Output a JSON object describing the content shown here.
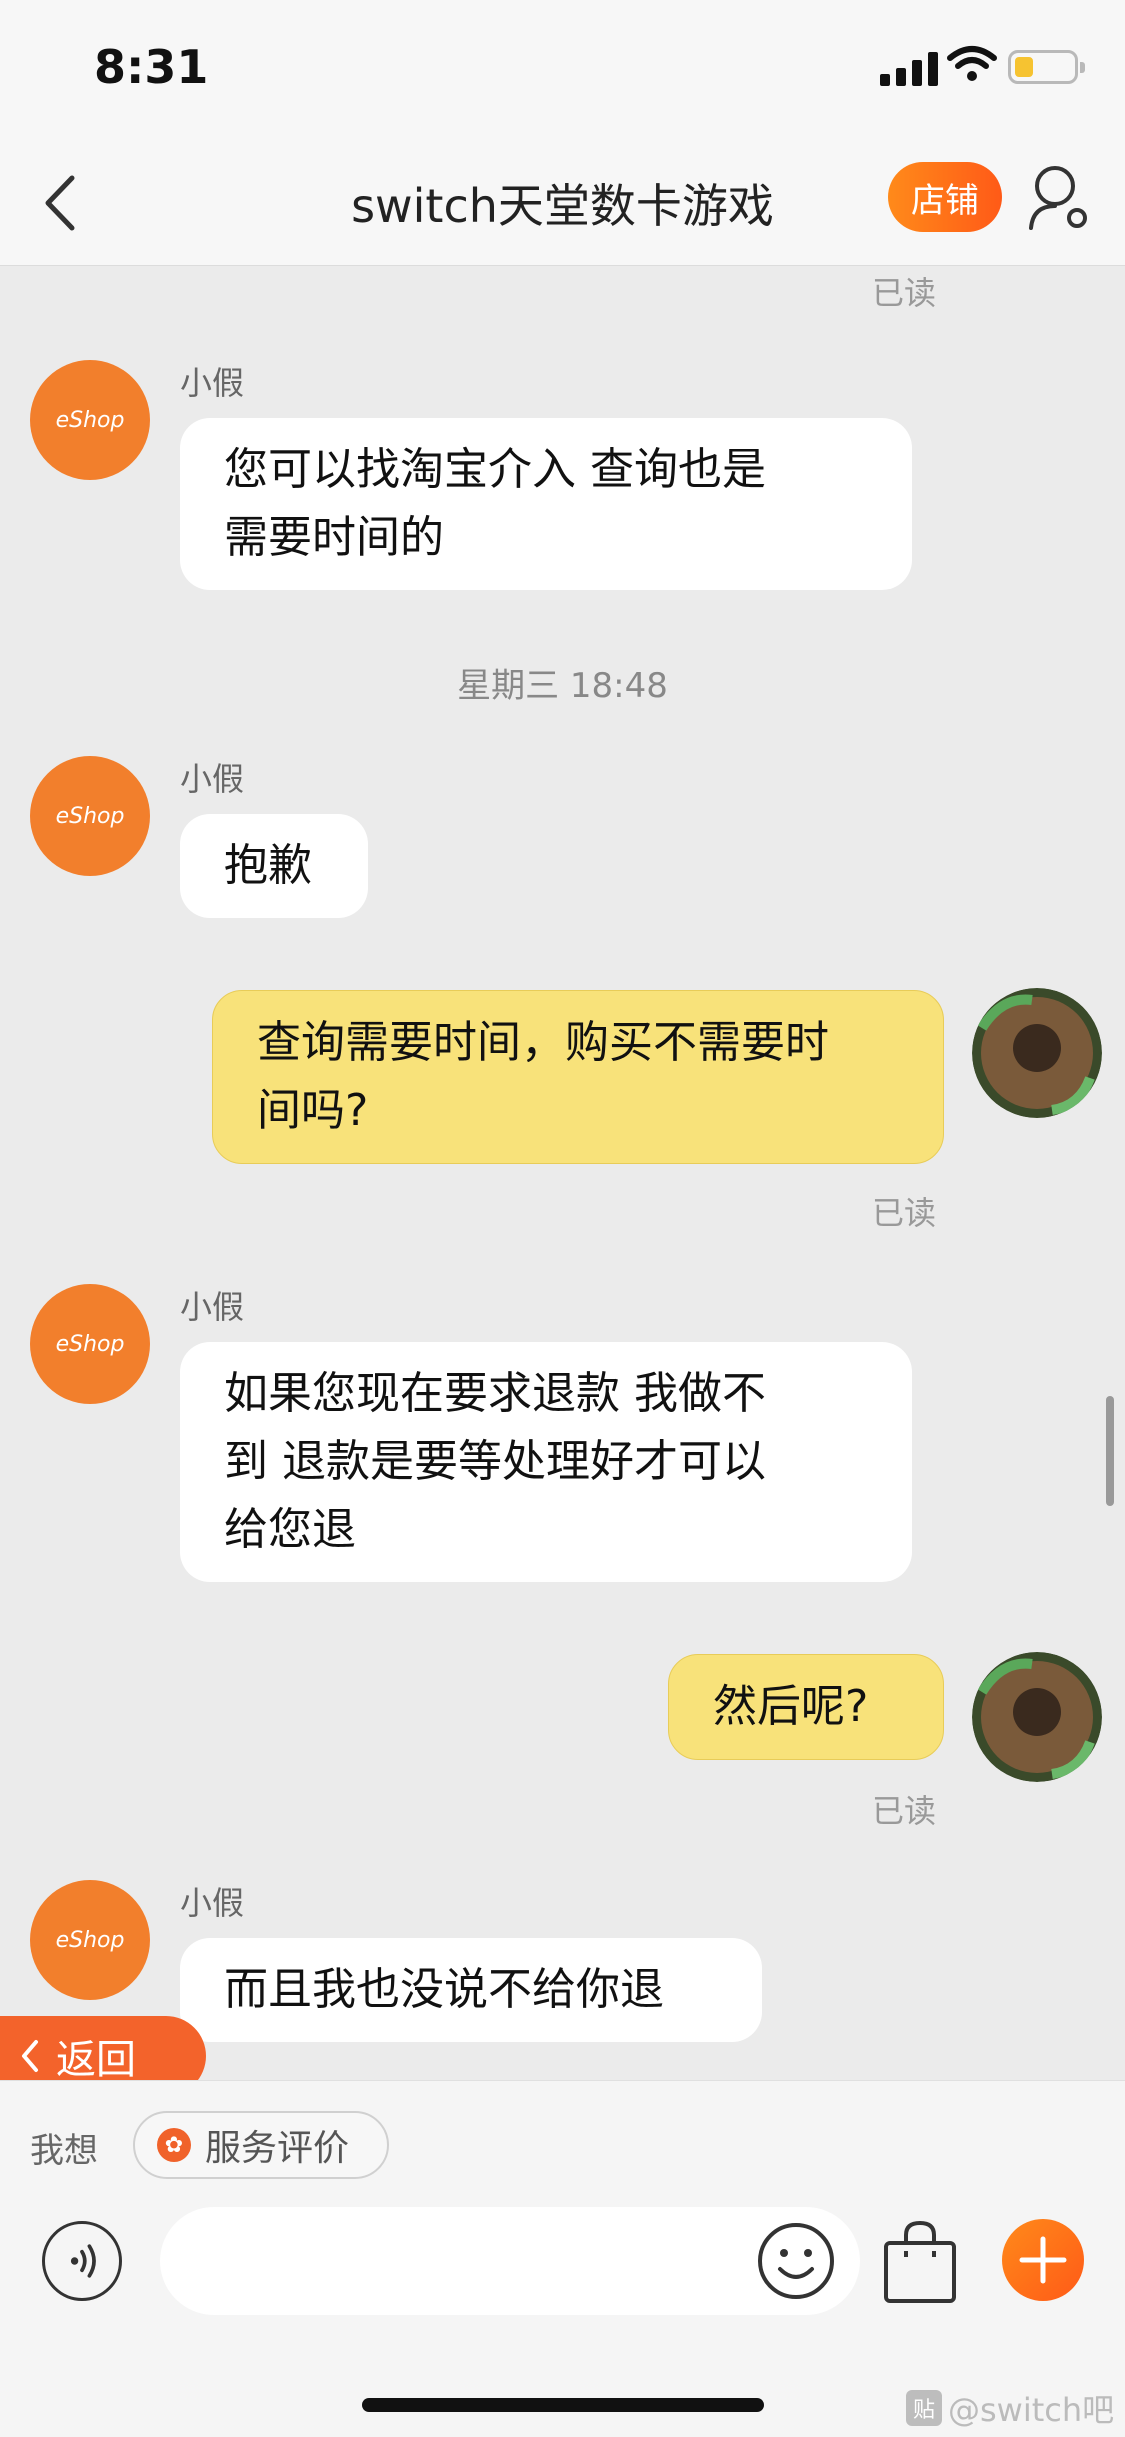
{
  "status": {
    "time": "8:31"
  },
  "nav": {
    "title": "switch天堂数卡游戏",
    "shop_label": "店铺"
  },
  "avatar_text": "eShop",
  "messages": {
    "read0": "已读",
    "m1": {
      "sender": "小假",
      "text_l1": "您可以找淘宝介入  查询也是",
      "text_l2": "需要时间的"
    },
    "stamp1": "星期三 18:48",
    "m2": {
      "sender": "小假",
      "text": "抱歉"
    },
    "m3": {
      "text_l1": "查询需要时间，购买不需要时",
      "text_l2": "间吗?"
    },
    "read1": "已读",
    "m4": {
      "sender": "小假",
      "text_l1": "如果您现在要求退款  我做不",
      "text_l2": "到 退款是要等处理好才可以",
      "text_l3": "给您退"
    },
    "m5": {
      "text": "然后呢?"
    },
    "read2": "已读",
    "m6": {
      "sender": "小假",
      "text": "而且我也没说不给你退"
    }
  },
  "return_button": {
    "label": "返回"
  },
  "bottom": {
    "wish_label": "我想",
    "eval_chip": "服务评价",
    "input_value": ""
  },
  "watermark": {
    "text": "@switch吧",
    "badge": "贴"
  },
  "colors": {
    "accent": "#ff6a1a",
    "my_bubble": "#f8e27a",
    "background": "#ebebeb"
  }
}
